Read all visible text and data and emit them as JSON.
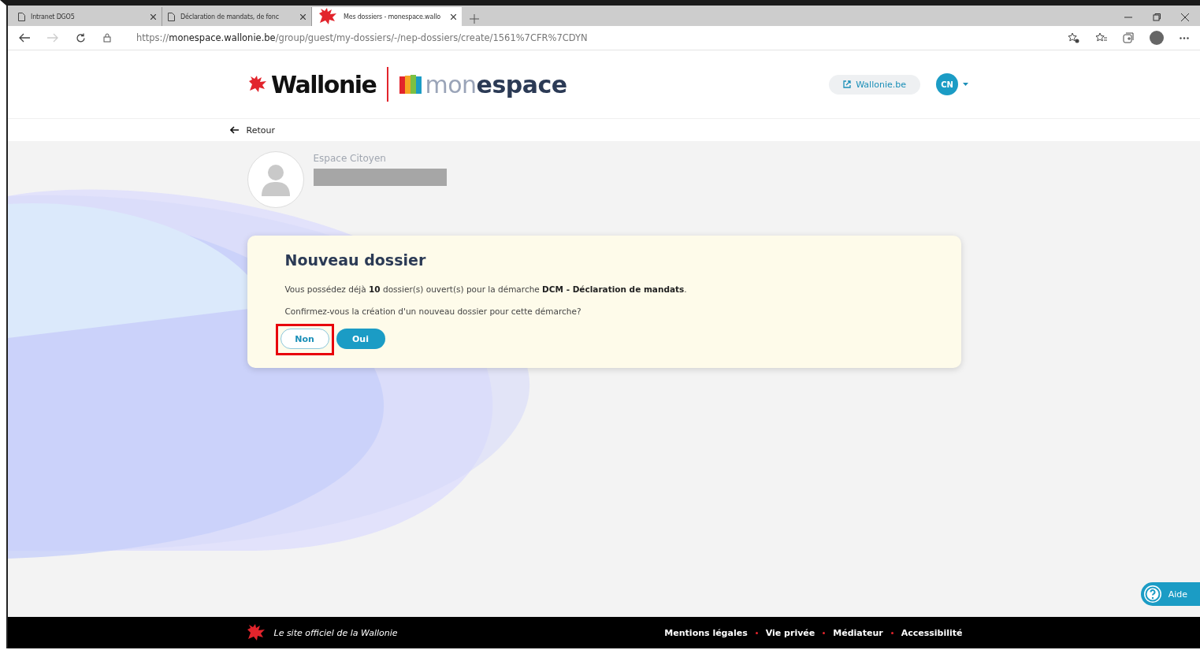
{
  "browser": {
    "tabs": [
      {
        "title": "Intranet DGO5",
        "selected": false,
        "kind": "page"
      },
      {
        "title": "Déclaration de mandats, de fonc",
        "selected": false,
        "kind": "page"
      },
      {
        "title": "Mes dossiers - monespace.wallo",
        "selected": true,
        "kind": "site"
      }
    ],
    "url": {
      "scheme": "https://",
      "host": "monespace.wallonie.be",
      "path": "/group/guest/my-dossiers/-/nep-dossiers/create/1561%7CFR%7CDYN"
    }
  },
  "header": {
    "brand": "Wallonie",
    "product_light": "mon",
    "product_bold": "espace",
    "site_link": "Wallonie.be",
    "user_initials": "CN"
  },
  "back_link": "Retour",
  "profile": {
    "space": "Espace Citoyen"
  },
  "dialog": {
    "title": "Nouveau dossier",
    "message": "Vous possédez déjà **10** dossier(s) ouvert(s) pour la démarche **DCM - Déclaration de mandats**.",
    "question": "Confirmez-vous la création d'un nouveau dossier pour cette démarche?",
    "buttons": [
      {
        "label": "Non",
        "kind": "secondary",
        "highlighted": true
      },
      {
        "label": "Oui",
        "kind": "primary",
        "highlighted": false
      }
    ]
  },
  "help_button": "Aide",
  "footer": {
    "tagline": "Le site officiel de la Wallonie",
    "links": [
      "Mentions légales",
      "Vie privée",
      "Médiateur",
      "Accessibilité"
    ]
  }
}
